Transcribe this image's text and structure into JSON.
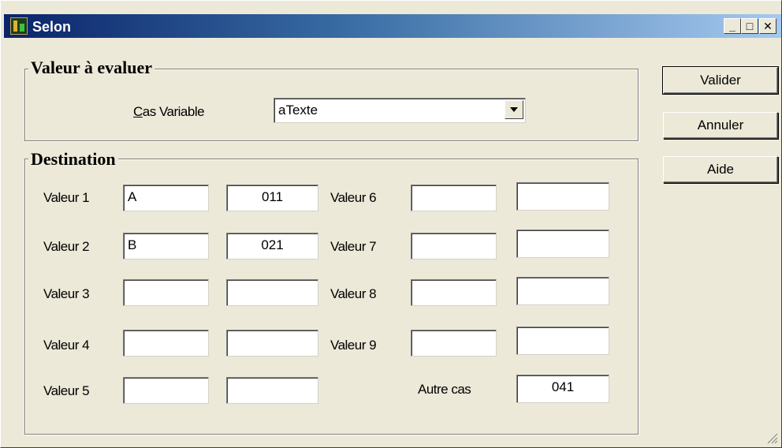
{
  "window": {
    "title": "Selon",
    "min_glyph": "_",
    "max_glyph": "□",
    "close_glyph": "✕"
  },
  "evaluate": {
    "legend": "Valeur à evaluer",
    "cas_label_accel": "C",
    "cas_label_rest": "as Variable",
    "selected": "aTexte"
  },
  "destination": {
    "legend": "Destination",
    "rows_left": [
      {
        "label": "Valeur 1",
        "value": "A",
        "code": "011"
      },
      {
        "label": "Valeur 2",
        "value": "B",
        "code": "021"
      },
      {
        "label": "Valeur 3",
        "value": "",
        "code": ""
      },
      {
        "label": "Valeur 4",
        "value": "",
        "code": ""
      },
      {
        "label": "Valeur 5",
        "value": "",
        "code": ""
      }
    ],
    "rows_right": [
      {
        "label": "Valeur 6",
        "value": "",
        "code": ""
      },
      {
        "label": "Valeur 7",
        "value": "",
        "code": ""
      },
      {
        "label": "Valeur 8",
        "value": "",
        "code": ""
      },
      {
        "label": "Valeur 9",
        "value": "",
        "code": ""
      }
    ],
    "autre_label": "Autre cas",
    "autre_code": "041"
  },
  "buttons": {
    "valider": "Valider",
    "annuler": "Annuler",
    "aide": "Aide"
  }
}
